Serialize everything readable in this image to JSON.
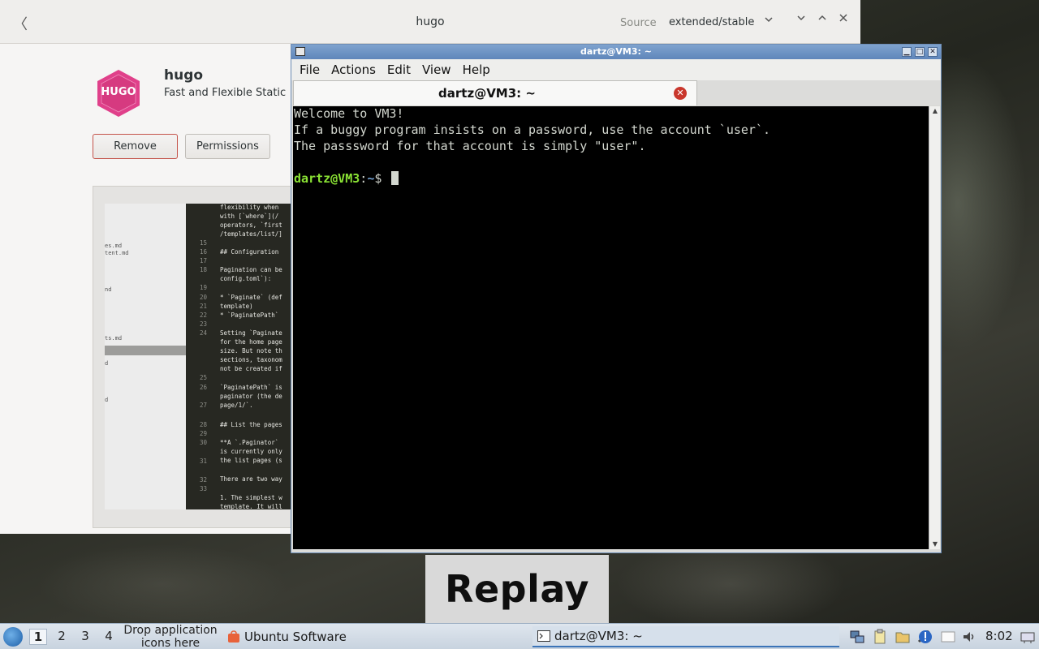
{
  "software": {
    "title": "hugo",
    "source_label": "Source",
    "source_value": "extended/stable",
    "app_name": "hugo",
    "app_summary": "Fast and Flexible Static",
    "icon_text": "HUGO",
    "remove_label": "Remove",
    "permissions_label": "Permissions",
    "screenshot": {
      "files": [
        "es.md",
        "tent.md",
        "nd",
        "ts.md",
        "d",
        "d"
      ],
      "line_numbers": [
        "15",
        "16",
        "17",
        "18",
        "19",
        "20",
        "21",
        "22",
        "23",
        "24",
        "25",
        "26",
        "27",
        "28",
        "29",
        "30",
        "31",
        "32",
        "33"
      ],
      "code_lines": [
        "flexibility when",
        "with [`where`](/",
        "operators, `first",
        "/templates/list/]",
        "## Configuration",
        "Pagination can be",
        "config.toml`):",
        "* `Paginate` (def",
        "template)",
        "* `PaginatePath`",
        "Setting `Paginate",
        "for the home page",
        "size. But note th",
        "sections, taxonom",
        "not be created if",
        "`PaginatePath` is",
        "paginator (the de",
        "page/1/`.",
        "## List the pages",
        "**A `.Paginator`",
        "is currently only",
        "the list pages (s",
        "There are two way",
        "1. The simplest w",
        "template. It will"
      ]
    }
  },
  "terminal": {
    "window_title": "dartz@VM3: ~",
    "menu": [
      "File",
      "Actions",
      "Edit",
      "View",
      "Help"
    ],
    "tab_title": "dartz@VM3: ~",
    "lines": [
      "Welcome to VM3!",
      "If a buggy program insists on a password, use the account `user`.",
      "The passsword for that account is simply \"user\"."
    ],
    "prompt_user": "dartz@VM3",
    "prompt_sep": ":",
    "prompt_path": "~",
    "prompt_symbol": "$"
  },
  "overlay": {
    "replay_label": "Replay"
  },
  "taskbar": {
    "workspaces": [
      "1",
      "2",
      "3",
      "4"
    ],
    "active_workspace": "1",
    "drop_hint": "Drop application icons here",
    "tasks": [
      {
        "label": "Ubuntu Software",
        "icon": "ubuntu-software-icon"
      },
      {
        "label": "dartz@VM3: ~",
        "icon": "terminal-icon"
      }
    ],
    "tray_icons": [
      "network-icon",
      "clipboard-icon",
      "file-manager-icon",
      "tools-icon",
      "update-alert-icon",
      "notes-icon",
      "volume-icon",
      "power-icon"
    ],
    "clock": "8:02"
  },
  "colors": {
    "hugo_pink": "#e0408a",
    "prompt_green": "#8ae234",
    "prompt_blue": "#729fcf",
    "remove_border": "#c4534a",
    "titlebar_blue": "#6a90c2"
  }
}
